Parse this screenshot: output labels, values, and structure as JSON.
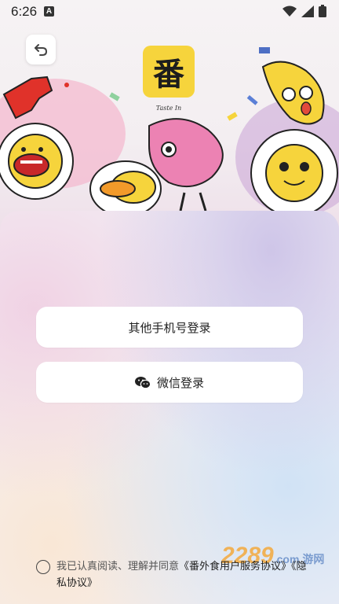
{
  "status_bar": {
    "time": "6:26",
    "notif_letter": "A"
  },
  "header": {
    "logo_char": "番",
    "logo_caption": "Taste In"
  },
  "buttons": {
    "other_phone_login": "其他手机号登录",
    "wechat_login": "微信登录"
  },
  "agreement": {
    "prefix": "我已认真阅读、理解并同意",
    "user_agreement": "《番外食用户服务协议》",
    "privacy_policy": "《隐私协议》"
  },
  "watermark": {
    "text": "2289",
    "sub": ".com 游网"
  },
  "colors": {
    "logo_bg": "#f6d43c",
    "button_bg": "#ffffff",
    "watermark": "#f4a93c"
  }
}
